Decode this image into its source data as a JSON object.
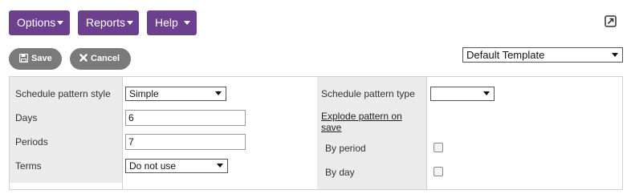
{
  "menu": {
    "options": "Options",
    "reports": "Reports",
    "help": "Help"
  },
  "actions": {
    "save": "Save",
    "cancel": "Cancel"
  },
  "template": {
    "selected": "Default Template"
  },
  "form": {
    "schedule_pattern_style": {
      "label": "Schedule pattern style",
      "value": "Simple"
    },
    "days": {
      "label": "Days",
      "value": "6"
    },
    "periods": {
      "label": "Periods",
      "value": "7"
    },
    "terms": {
      "label": "Terms",
      "value": "Do not use"
    },
    "schedule_pattern_type": {
      "label": "Schedule pattern type",
      "value": ""
    },
    "explode_link": "Explode pattern on save",
    "by_period": {
      "label": "By period",
      "checked": false
    },
    "by_day": {
      "label": "By day",
      "checked": false
    }
  },
  "colors": {
    "menu_bg": "#6d3f8f",
    "action_bg": "#7a7a7a",
    "label_bg": "#ebebeb"
  }
}
